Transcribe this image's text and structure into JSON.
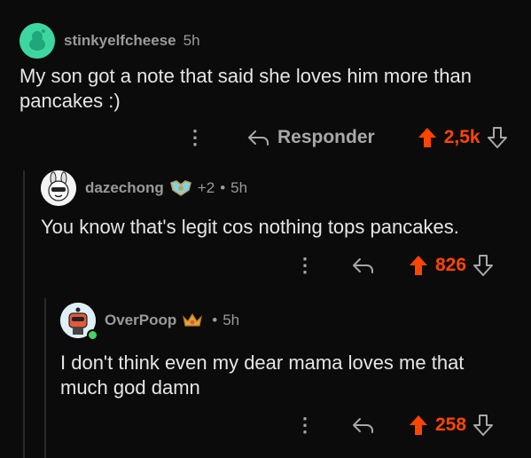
{
  "comments": [
    {
      "username": "stinkyelfcheese",
      "time": "5h",
      "text": "My son got a note that said she loves him more than pancakes :)",
      "reply_label": "Responder",
      "score": "2,5k",
      "avatar_color": "#3dd6a0"
    },
    {
      "username": "dazechong",
      "awards": "+2",
      "separator": "•",
      "time": "5h",
      "text": "You know that's legit cos nothing tops pancakes.",
      "score": "826"
    },
    {
      "username": "OverPoop",
      "separator": "•",
      "time": "5h",
      "text": "I don't think even my dear mama loves me that much god damn",
      "score": "258"
    }
  ],
  "colors": {
    "upvote_accent": "#ff4500",
    "muted_text": "#9a9a9a",
    "background": "#0b0b0b"
  },
  "icons": {
    "kebab": "more-vertical-icon",
    "reply": "reply-arrow-icon",
    "upvote": "upvote-arrow-icon",
    "downvote": "downvote-arrow-icon"
  },
  "glyphs": {
    "kebab": "⋮"
  }
}
